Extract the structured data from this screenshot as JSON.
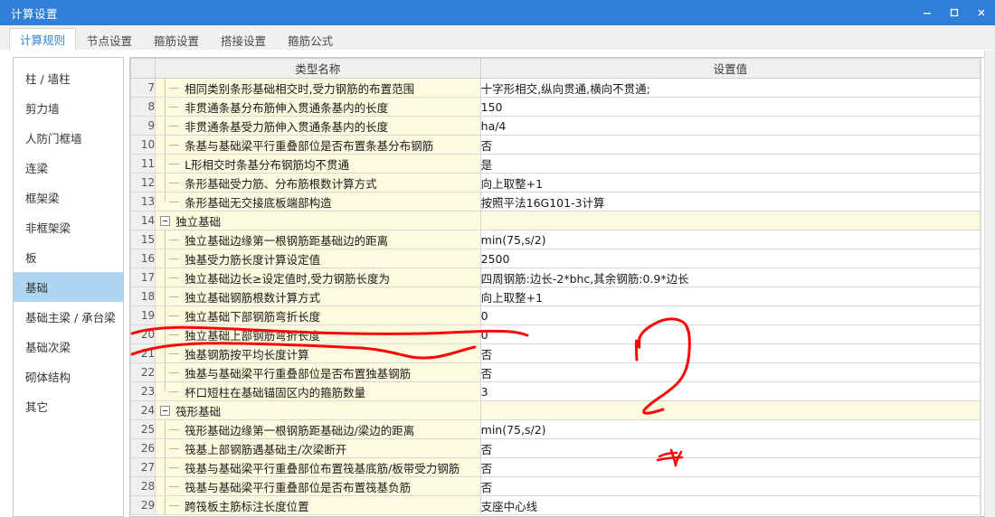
{
  "window": {
    "title": "计算设置",
    "controls": [
      {
        "name": "minimize",
        "glyph": "minimize-icon"
      },
      {
        "name": "maximize",
        "glyph": "maximize-icon"
      },
      {
        "name": "close",
        "glyph": "close-icon"
      }
    ],
    "accent_color": "#2f7fd8"
  },
  "tabs": [
    {
      "label": "计算规则",
      "active": true
    },
    {
      "label": "节点设置",
      "active": false
    },
    {
      "label": "箍筋设置",
      "active": false
    },
    {
      "label": "搭接设置",
      "active": false
    },
    {
      "label": "箍筋公式",
      "active": false
    }
  ],
  "sidebar": {
    "items": [
      {
        "label": "柱 / 墙柱",
        "selected": false
      },
      {
        "label": "剪力墙",
        "selected": false
      },
      {
        "label": "人防门框墙",
        "selected": false
      },
      {
        "label": "连梁",
        "selected": false
      },
      {
        "label": "框架梁",
        "selected": false
      },
      {
        "label": "非框架梁",
        "selected": false
      },
      {
        "label": "板",
        "selected": false
      },
      {
        "label": "基础",
        "selected": true
      },
      {
        "label": "基础主梁 / 承台梁",
        "selected": false
      },
      {
        "label": "基础次梁",
        "selected": false
      },
      {
        "label": "砌体结构",
        "selected": false
      },
      {
        "label": "其它",
        "selected": false
      }
    ],
    "selected_color": "#aed6f1"
  },
  "grid": {
    "columns": [
      "",
      "类型名称",
      "设置值"
    ],
    "rows": [
      {
        "num": "7",
        "type": "child",
        "last": false,
        "name": "相同类别条形基础相交时,受力钢筋的布置范围",
        "value": "十字形相交,纵向贯通,横向不贯通;"
      },
      {
        "num": "8",
        "type": "child",
        "last": false,
        "name": "非贯通条基分布筋伸入贯通条基内的长度",
        "value": "150"
      },
      {
        "num": "9",
        "type": "child",
        "last": false,
        "name": "非贯通条基受力筋伸入贯通条基内的长度",
        "value": "ha/4"
      },
      {
        "num": "10",
        "type": "child",
        "last": false,
        "name": "条基与基础梁平行重叠部位是否布置条基分布钢筋",
        "value": "否"
      },
      {
        "num": "11",
        "type": "child",
        "last": false,
        "name": "L形相交时条基分布钢筋均不贯通",
        "value": "是"
      },
      {
        "num": "12",
        "type": "child",
        "last": false,
        "name": "条形基础受力筋、分布筋根数计算方式",
        "value": "向上取整+1"
      },
      {
        "num": "13",
        "type": "child",
        "last": true,
        "name": "条形基础无交接底板端部构造",
        "value": "按照平法16G101-3计算"
      },
      {
        "num": "14",
        "type": "group",
        "last": false,
        "name": "独立基础",
        "value": ""
      },
      {
        "num": "15",
        "type": "child",
        "last": false,
        "name": "独立基础边缘第一根钢筋距基础边的距离",
        "value": "min(75,s/2)"
      },
      {
        "num": "16",
        "type": "child",
        "last": false,
        "name": "独基受力筋长度计算设定值",
        "value": "2500"
      },
      {
        "num": "17",
        "type": "child",
        "last": false,
        "name": "独立基础边长≥设定值时,受力钢筋长度为",
        "value": "四周钢筋:边长-2*bhc,其余钢筋:0.9*边长"
      },
      {
        "num": "18",
        "type": "child",
        "last": false,
        "name": "独立基础钢筋根数计算方式",
        "value": "向上取整+1"
      },
      {
        "num": "19",
        "type": "child",
        "last": false,
        "name": "独立基础下部钢筋弯折长度",
        "value": "0"
      },
      {
        "num": "20",
        "type": "child",
        "last": false,
        "name": "独立基础上部钢筋弯折长度",
        "value": "0"
      },
      {
        "num": "21",
        "type": "child",
        "last": false,
        "name": "独基钢筋按平均长度计算",
        "value": "否"
      },
      {
        "num": "22",
        "type": "child",
        "last": false,
        "name": "独基与基础梁平行重叠部位是否布置独基钢筋",
        "value": "否"
      },
      {
        "num": "23",
        "type": "child",
        "last": true,
        "name": "杯口短柱在基础锚固区内的箍筋数量",
        "value": "3"
      },
      {
        "num": "24",
        "type": "group",
        "last": false,
        "name": "筏形基础",
        "value": ""
      },
      {
        "num": "25",
        "type": "child",
        "last": false,
        "name": "筏形基础边缘第一根钢筋距基础边/梁边的距离",
        "value": "min(75,s/2)"
      },
      {
        "num": "26",
        "type": "child",
        "last": false,
        "name": "筏基上部钢筋遇基础主/次梁断开",
        "value": "否"
      },
      {
        "num": "27",
        "type": "child",
        "last": false,
        "name": "筏基与基础梁平行重叠部位布置筏基底筋/板带受力钢筋",
        "value": "否"
      },
      {
        "num": "28",
        "type": "child",
        "last": false,
        "name": "筏基与基础梁平行重叠部位是否布置筏基负筋",
        "value": "否"
      },
      {
        "num": "29",
        "type": "child",
        "last": false,
        "name": "跨筏板主筋标注长度位置",
        "value": "支座中心线"
      }
    ]
  },
  "scrollbar": {
    "up_arrow": "scroll-up-arrow-icon",
    "thumb": "scroll-thumb"
  },
  "annotations": {
    "color": "#fb0606",
    "marks": [
      {
        "name": "underline-row-19",
        "shape": "freehand-underline"
      },
      {
        "name": "underline-row-20",
        "shape": "freehand-underline"
      },
      {
        "name": "question-mark-scribble",
        "shape": "freehand-question-mark"
      },
      {
        "name": "small-scribble",
        "shape": "freehand-scribble"
      }
    ]
  }
}
